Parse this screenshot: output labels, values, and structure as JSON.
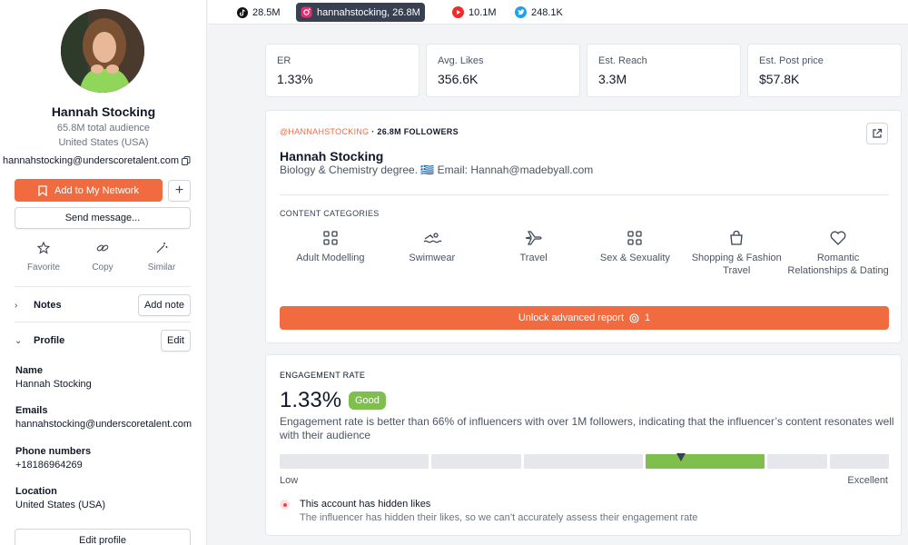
{
  "sidebar": {
    "name": "Hannah Stocking",
    "audience": "65.8M total audience",
    "country": "United States (USA)",
    "email": "hannahstocking@underscoretalent.com",
    "add_network_label": "Add to My Network",
    "send_message_label": "Send message...",
    "actions": [
      {
        "label": "Favorite",
        "icon": "star-icon"
      },
      {
        "label": "Copy",
        "icon": "link-icon"
      },
      {
        "label": "Similar",
        "icon": "magic-wand-icon"
      }
    ],
    "notes_label": "Notes",
    "add_note_label": "Add note",
    "profile_label": "Profile",
    "edit_label": "Edit",
    "fields": [
      {
        "label": "Name",
        "value": "Hannah Stocking"
      },
      {
        "label": "Emails",
        "value": "hannahstocking@underscoretalent.com"
      },
      {
        "label": "Phone numbers",
        "value": "+18186964269"
      },
      {
        "label": "Location",
        "value": "United States (USA)"
      }
    ],
    "edit_profile_label": "Edit profile"
  },
  "platforms": [
    {
      "icon": "tiktok-icon",
      "label": "28.5M",
      "active": false
    },
    {
      "icon": "instagram-icon",
      "label": "hannahstocking,  26.8M",
      "active": true
    },
    {
      "icon": "youtube-icon",
      "label": "10.1M",
      "active": false
    },
    {
      "icon": "twitter-icon",
      "label": "248.1K",
      "active": false
    }
  ],
  "stats": [
    {
      "label": "ER",
      "value": "1.33%"
    },
    {
      "label": "Avg. Likes",
      "value": "356.6K"
    },
    {
      "label": "Est. Reach",
      "value": "3.3M"
    },
    {
      "label": "Est. Post price",
      "value": "$57.8K"
    }
  ],
  "profile_card": {
    "handle": "@HANNAHSTOCKING",
    "followers": " · 26.8M FOLLOWERS",
    "name": "Hannah Stocking",
    "bio": "Biology & Chemistry degree. 🇬🇷 Email: Hannah@madebyall.com",
    "categories_title": "CONTENT CATEGORIES",
    "categories": [
      {
        "label": "Adult Modelling",
        "icon": "grid-icon"
      },
      {
        "label": "Swimwear",
        "icon": "swimmer-icon"
      },
      {
        "label": "Travel",
        "icon": "airplane-icon"
      },
      {
        "label": "Sex & Sexuality",
        "icon": "grid-icon"
      },
      {
        "label": "Shopping & Fashion Travel",
        "icon": "shopping-bag-icon"
      },
      {
        "label": "Romantic Relationships & Dating",
        "icon": "heart-icon"
      }
    ],
    "unlock_label": "Unlock advanced report",
    "unlock_cost": "1"
  },
  "engagement": {
    "title": "ENGAGEMENT RATE",
    "value": "1.33%",
    "badge": "Good",
    "description": "Engagement rate is better than 66% of influencers with over 1M followers, indicating that the influencer’s content resonates well with their audience",
    "scale_low": "Low",
    "scale_high": "Excellent",
    "active_segment": 3,
    "hidden_title": "This account has hidden likes",
    "hidden_desc": "The influencer has hidden their likes, so we can’t accurately assess their engagement rate"
  },
  "colors": {
    "accent": "#f06b3f",
    "good": "#7fbf4d"
  }
}
